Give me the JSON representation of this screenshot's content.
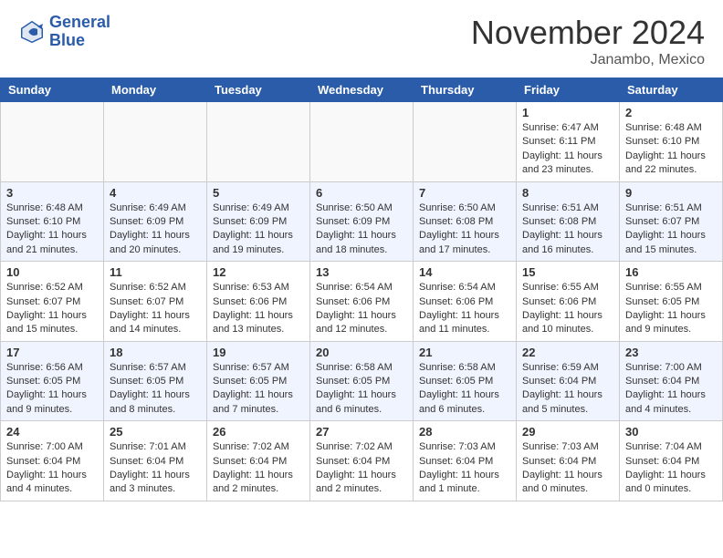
{
  "header": {
    "logo_line1": "General",
    "logo_line2": "Blue",
    "month": "November 2024",
    "location": "Janambo, Mexico"
  },
  "weekdays": [
    "Sunday",
    "Monday",
    "Tuesday",
    "Wednesday",
    "Thursday",
    "Friday",
    "Saturday"
  ],
  "weeks": [
    [
      {
        "day": "",
        "empty": true
      },
      {
        "day": "",
        "empty": true
      },
      {
        "day": "",
        "empty": true
      },
      {
        "day": "",
        "empty": true
      },
      {
        "day": "",
        "empty": true
      },
      {
        "day": "1",
        "sunrise": "Sunrise: 6:47 AM",
        "sunset": "Sunset: 6:11 PM",
        "daylight": "Daylight: 11 hours and 23 minutes."
      },
      {
        "day": "2",
        "sunrise": "Sunrise: 6:48 AM",
        "sunset": "Sunset: 6:10 PM",
        "daylight": "Daylight: 11 hours and 22 minutes."
      }
    ],
    [
      {
        "day": "3",
        "sunrise": "Sunrise: 6:48 AM",
        "sunset": "Sunset: 6:10 PM",
        "daylight": "Daylight: 11 hours and 21 minutes."
      },
      {
        "day": "4",
        "sunrise": "Sunrise: 6:49 AM",
        "sunset": "Sunset: 6:09 PM",
        "daylight": "Daylight: 11 hours and 20 minutes."
      },
      {
        "day": "5",
        "sunrise": "Sunrise: 6:49 AM",
        "sunset": "Sunset: 6:09 PM",
        "daylight": "Daylight: 11 hours and 19 minutes."
      },
      {
        "day": "6",
        "sunrise": "Sunrise: 6:50 AM",
        "sunset": "Sunset: 6:09 PM",
        "daylight": "Daylight: 11 hours and 18 minutes."
      },
      {
        "day": "7",
        "sunrise": "Sunrise: 6:50 AM",
        "sunset": "Sunset: 6:08 PM",
        "daylight": "Daylight: 11 hours and 17 minutes."
      },
      {
        "day": "8",
        "sunrise": "Sunrise: 6:51 AM",
        "sunset": "Sunset: 6:08 PM",
        "daylight": "Daylight: 11 hours and 16 minutes."
      },
      {
        "day": "9",
        "sunrise": "Sunrise: 6:51 AM",
        "sunset": "Sunset: 6:07 PM",
        "daylight": "Daylight: 11 hours and 15 minutes."
      }
    ],
    [
      {
        "day": "10",
        "sunrise": "Sunrise: 6:52 AM",
        "sunset": "Sunset: 6:07 PM",
        "daylight": "Daylight: 11 hours and 15 minutes."
      },
      {
        "day": "11",
        "sunrise": "Sunrise: 6:52 AM",
        "sunset": "Sunset: 6:07 PM",
        "daylight": "Daylight: 11 hours and 14 minutes."
      },
      {
        "day": "12",
        "sunrise": "Sunrise: 6:53 AM",
        "sunset": "Sunset: 6:06 PM",
        "daylight": "Daylight: 11 hours and 13 minutes."
      },
      {
        "day": "13",
        "sunrise": "Sunrise: 6:54 AM",
        "sunset": "Sunset: 6:06 PM",
        "daylight": "Daylight: 11 hours and 12 minutes."
      },
      {
        "day": "14",
        "sunrise": "Sunrise: 6:54 AM",
        "sunset": "Sunset: 6:06 PM",
        "daylight": "Daylight: 11 hours and 11 minutes."
      },
      {
        "day": "15",
        "sunrise": "Sunrise: 6:55 AM",
        "sunset": "Sunset: 6:06 PM",
        "daylight": "Daylight: 11 hours and 10 minutes."
      },
      {
        "day": "16",
        "sunrise": "Sunrise: 6:55 AM",
        "sunset": "Sunset: 6:05 PM",
        "daylight": "Daylight: 11 hours and 9 minutes."
      }
    ],
    [
      {
        "day": "17",
        "sunrise": "Sunrise: 6:56 AM",
        "sunset": "Sunset: 6:05 PM",
        "daylight": "Daylight: 11 hours and 9 minutes."
      },
      {
        "day": "18",
        "sunrise": "Sunrise: 6:57 AM",
        "sunset": "Sunset: 6:05 PM",
        "daylight": "Daylight: 11 hours and 8 minutes."
      },
      {
        "day": "19",
        "sunrise": "Sunrise: 6:57 AM",
        "sunset": "Sunset: 6:05 PM",
        "daylight": "Daylight: 11 hours and 7 minutes."
      },
      {
        "day": "20",
        "sunrise": "Sunrise: 6:58 AM",
        "sunset": "Sunset: 6:05 PM",
        "daylight": "Daylight: 11 hours and 6 minutes."
      },
      {
        "day": "21",
        "sunrise": "Sunrise: 6:58 AM",
        "sunset": "Sunset: 6:05 PM",
        "daylight": "Daylight: 11 hours and 6 minutes."
      },
      {
        "day": "22",
        "sunrise": "Sunrise: 6:59 AM",
        "sunset": "Sunset: 6:04 PM",
        "daylight": "Daylight: 11 hours and 5 minutes."
      },
      {
        "day": "23",
        "sunrise": "Sunrise: 7:00 AM",
        "sunset": "Sunset: 6:04 PM",
        "daylight": "Daylight: 11 hours and 4 minutes."
      }
    ],
    [
      {
        "day": "24",
        "sunrise": "Sunrise: 7:00 AM",
        "sunset": "Sunset: 6:04 PM",
        "daylight": "Daylight: 11 hours and 4 minutes."
      },
      {
        "day": "25",
        "sunrise": "Sunrise: 7:01 AM",
        "sunset": "Sunset: 6:04 PM",
        "daylight": "Daylight: 11 hours and 3 minutes."
      },
      {
        "day": "26",
        "sunrise": "Sunrise: 7:02 AM",
        "sunset": "Sunset: 6:04 PM",
        "daylight": "Daylight: 11 hours and 2 minutes."
      },
      {
        "day": "27",
        "sunrise": "Sunrise: 7:02 AM",
        "sunset": "Sunset: 6:04 PM",
        "daylight": "Daylight: 11 hours and 2 minutes."
      },
      {
        "day": "28",
        "sunrise": "Sunrise: 7:03 AM",
        "sunset": "Sunset: 6:04 PM",
        "daylight": "Daylight: 11 hours and 1 minute."
      },
      {
        "day": "29",
        "sunrise": "Sunrise: 7:03 AM",
        "sunset": "Sunset: 6:04 PM",
        "daylight": "Daylight: 11 hours and 0 minutes."
      },
      {
        "day": "30",
        "sunrise": "Sunrise: 7:04 AM",
        "sunset": "Sunset: 6:04 PM",
        "daylight": "Daylight: 11 hours and 0 minutes."
      }
    ]
  ]
}
